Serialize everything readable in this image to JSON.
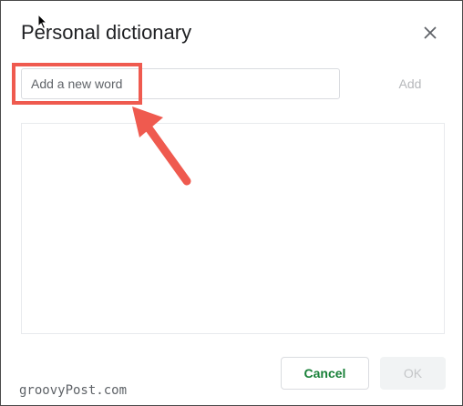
{
  "dialog": {
    "title": "Personal dictionary",
    "input_placeholder": "Add a new word",
    "add_label": "Add",
    "cancel_label": "Cancel",
    "ok_label": "OK"
  },
  "watermark": "groovyPost.com",
  "colors": {
    "highlight": "#ef5a4f",
    "cancel_text": "#188038",
    "disabled_text": "#b6b8bb"
  },
  "icons": {
    "close": "close-icon",
    "arrow": "arrow-annotation-icon",
    "cursor": "mouse-cursor-icon"
  }
}
